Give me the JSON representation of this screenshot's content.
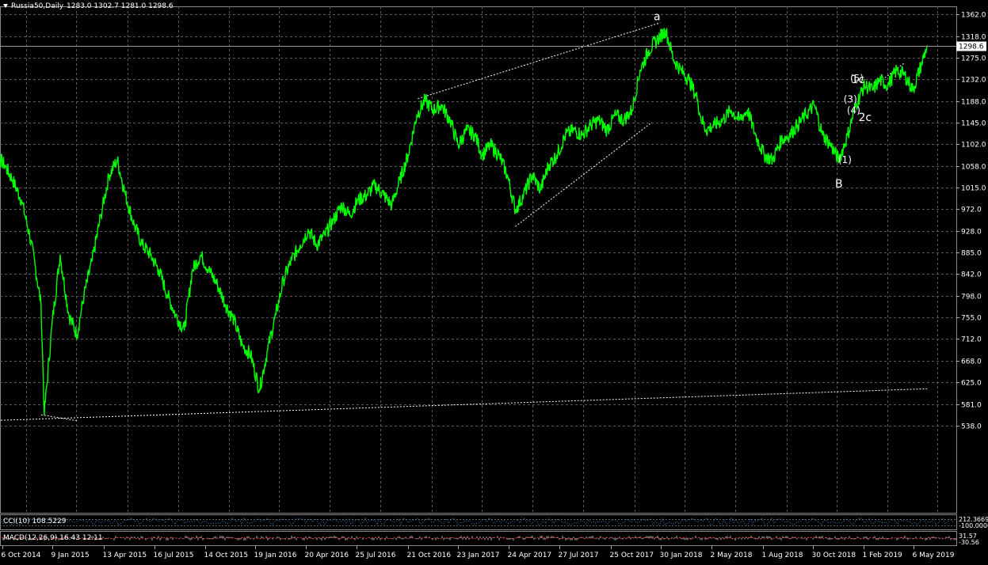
{
  "header": {
    "symbol": "Russia50,Daily",
    "ohlc": "1283.0 1302.7 1281.0 1298.6"
  },
  "current_price_label": "1298.6",
  "colors": {
    "background": "#000000",
    "grid": "#5a5a5a",
    "price_line": "#00ff00",
    "axis_text": "#ffffff",
    "trendline": "#ffffff",
    "current_price_box": "#ffffff"
  },
  "y_axis_ticks": [
    "1362.0",
    "1318.0",
    "1275.0",
    "1232.0",
    "1188.0",
    "1145.0",
    "1102.0",
    "1058.0",
    "1015.0",
    "972.0",
    "928.0",
    "885.0",
    "842.0",
    "798.0",
    "755.0",
    "712.0",
    "668.0",
    "625.0",
    "581.0",
    "538.0"
  ],
  "x_axis_ticks": [
    "6 Oct 2014",
    "9 Jan 2015",
    "13 Apr 2015",
    "16 Jul 2015",
    "14 Oct 2015",
    "19 Jan 2016",
    "20 Apr 2016",
    "25 Jul 2016",
    "21 Oct 2016",
    "23 Jan 2017",
    "24 Apr 2017",
    "27 Jul 2017",
    "25 Oct 2017",
    "30 Jan 2018",
    "2 May 2018",
    "1 Aug 2018",
    "30 Oct 2018",
    "1 Feb 2019",
    "6 May 2019"
  ],
  "annotations": [
    {
      "text": "a",
      "date": "2018-01-20",
      "price": 1350
    },
    {
      "text": "B",
      "date": "2018-12-20",
      "price": 1015
    },
    {
      "text": "1c",
      "date": "2019-01-24",
      "price": 1224
    },
    {
      "text": "2c",
      "date": "2019-02-06",
      "price": 1148
    },
    {
      "text": "(1)",
      "date": "2018-12-31",
      "price": 1064
    },
    {
      "text": "(3)",
      "date": "2019-01-10",
      "price": 1185
    },
    {
      "text": "(4)",
      "date": "2019-01-16",
      "price": 1163
    },
    {
      "text": "(5)",
      "date": "2019-01-22",
      "price": 1227
    }
  ],
  "indicators": {
    "cci": {
      "label": "CCI(10) 108.5229",
      "right_values": [
        "212.3669",
        "-100.0000"
      ]
    },
    "macd": {
      "label": "MACD(12,26,9) 16.43 12.11",
      "right_values": [
        "31.57",
        "-30.56"
      ]
    }
  },
  "chart_data": {
    "type": "line",
    "title": "Russia50,Daily",
    "x_type": "date",
    "ylim": [
      520,
      1375
    ],
    "x": [
      "2014-09-10",
      "2014-09-25",
      "2014-10-10",
      "2014-10-25",
      "2014-11-10",
      "2014-11-25",
      "2014-12-05",
      "2014-12-16",
      "2014-12-22",
      "2015-01-05",
      "2015-01-20",
      "2015-02-05",
      "2015-02-20",
      "2015-03-05",
      "2015-03-20",
      "2015-04-05",
      "2015-04-20",
      "2015-05-05",
      "2015-05-20",
      "2015-06-05",
      "2015-06-20",
      "2015-07-05",
      "2015-07-20",
      "2015-08-05",
      "2015-08-20",
      "2015-09-05",
      "2015-09-20",
      "2015-10-05",
      "2015-10-20",
      "2015-11-05",
      "2015-11-20",
      "2015-12-05",
      "2015-12-20",
      "2016-01-05",
      "2016-01-21",
      "2016-02-05",
      "2016-02-20",
      "2016-03-05",
      "2016-03-20",
      "2016-04-05",
      "2016-04-20",
      "2016-05-05",
      "2016-05-20",
      "2016-06-05",
      "2016-06-20",
      "2016-07-05",
      "2016-07-20",
      "2016-08-05",
      "2016-08-20",
      "2016-09-05",
      "2016-09-20",
      "2016-10-05",
      "2016-10-20",
      "2016-11-05",
      "2016-11-20",
      "2016-12-05",
      "2016-12-20",
      "2017-01-05",
      "2017-01-20",
      "2017-02-05",
      "2017-02-20",
      "2017-03-05",
      "2017-03-20",
      "2017-04-05",
      "2017-04-20",
      "2017-05-05",
      "2017-05-20",
      "2017-06-05",
      "2017-06-20",
      "2017-07-05",
      "2017-07-20",
      "2017-08-05",
      "2017-08-20",
      "2017-09-05",
      "2017-09-20",
      "2017-10-05",
      "2017-10-20",
      "2017-11-05",
      "2017-11-20",
      "2017-12-05",
      "2017-12-20",
      "2018-01-05",
      "2018-01-20",
      "2018-02-05",
      "2018-02-20",
      "2018-03-05",
      "2018-03-20",
      "2018-04-05",
      "2018-04-09",
      "2018-04-20",
      "2018-05-05",
      "2018-05-20",
      "2018-06-05",
      "2018-06-20",
      "2018-07-05",
      "2018-07-20",
      "2018-08-05",
      "2018-08-20",
      "2018-09-05",
      "2018-09-20",
      "2018-10-05",
      "2018-10-20",
      "2018-11-05",
      "2018-11-20",
      "2018-12-05",
      "2018-12-20",
      "2019-01-05",
      "2019-01-20",
      "2019-02-05",
      "2019-02-20",
      "2019-03-05",
      "2019-03-20",
      "2019-04-05",
      "2019-04-20",
      "2019-05-05",
      "2019-05-20",
      "2019-05-31"
    ],
    "series": [
      {
        "values": [
          1110,
          1080,
          1060,
          1030,
          990,
          920,
          860,
          780,
          560,
          740,
          880,
          760,
          720,
          800,
          870,
          960,
          1040,
          1070,
          1000,
          940,
          900,
          880,
          850,
          800,
          760,
          730,
          850,
          880,
          850,
          820,
          780,
          750,
          700,
          680,
          610,
          690,
          760,
          830,
          870,
          900,
          930,
          900,
          920,
          950,
          980,
          960,
          990,
          1000,
          1020,
          1000,
          980,
          1030,
          1080,
          1160,
          1190,
          1170,
          1180,
          1150,
          1100,
          1130,
          1120,
          1080,
          1100,
          1080,
          1040,
          970,
          1000,
          1040,
          1010,
          1060,
          1080,
          1120,
          1130,
          1120,
          1140,
          1150,
          1130,
          1160,
          1150,
          1170,
          1250,
          1290,
          1310,
          1330,
          1270,
          1250,
          1230,
          1190,
          1160,
          1130,
          1140,
          1150,
          1170,
          1150,
          1170,
          1120,
          1080,
          1070,
          1110,
          1120,
          1140,
          1160,
          1180,
          1120,
          1100,
          1070,
          1120,
          1180,
          1220,
          1210,
          1230,
          1220,
          1250,
          1240,
          1210,
          1260,
          1298.6
        ]
      }
    ],
    "trendlines": [
      {
        "from": [
          "2016-11-07",
          1193
        ],
        "to": [
          "2018-01-26",
          1345
        ]
      },
      {
        "from": [
          "2017-05-05",
          937
        ],
        "to": [
          "2018-01-10",
          1145
        ]
      },
      {
        "from": [
          "2014-09-10",
          548
        ],
        "to": [
          "2019-05-31",
          612
        ]
      },
      {
        "from": [
          "2014-12-16",
          560
        ],
        "to": [
          "2015-02-20",
          548
        ]
      },
      {
        "from": [
          "2019-03-05",
          1227
        ],
        "to": [
          "2019-04-20",
          1265
        ]
      }
    ],
    "current_price": 1298.6,
    "grid": true
  }
}
